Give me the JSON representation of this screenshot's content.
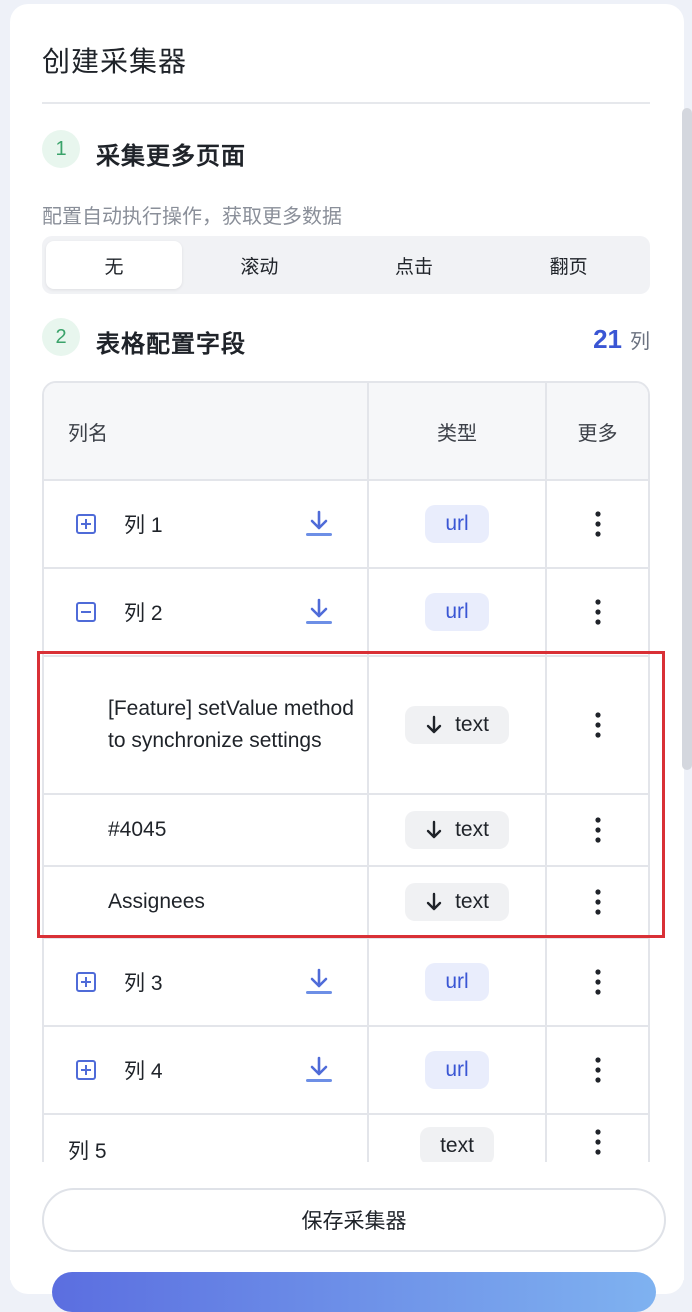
{
  "panel": {
    "title": "创建采集器"
  },
  "step1": {
    "num": "1",
    "title": "采集更多页面",
    "desc": "配置自动执行操作，获取更多数据"
  },
  "segments": [
    "无",
    "滚动",
    "点击",
    "翻页"
  ],
  "step2": {
    "num": "2",
    "title": "表格配置字段",
    "count": "21",
    "count_unit": "列"
  },
  "table": {
    "headers": {
      "name": "列名",
      "type": "类型",
      "more": "更多"
    },
    "rows": [
      {
        "name": "列 1",
        "type": "url",
        "expanded": false
      },
      {
        "name": "列 2",
        "type": "url",
        "expanded": true
      },
      {
        "name": "[Feature] setValue method to synchronize settings",
        "type": "text",
        "sub": true
      },
      {
        "name": "#4045",
        "type": "text",
        "sub": true
      },
      {
        "name": "Assignees",
        "type": "text",
        "sub": true
      },
      {
        "name": "列 3",
        "type": "url",
        "expanded": false
      },
      {
        "name": "列 4",
        "type": "url",
        "expanded": false
      },
      {
        "name": "列 5",
        "type": "text"
      }
    ]
  },
  "footer": {
    "save_label": "保存采集器"
  },
  "icons": {
    "expand": "plus-square-icon",
    "collapse": "minus-square-icon",
    "download": "download-icon",
    "arrow": "arrow-down-icon",
    "more": "kebab-icon"
  },
  "colors": {
    "accent": "#3a56d4",
    "step_green": "#3aa36a",
    "highlight_red": "#d93036"
  }
}
